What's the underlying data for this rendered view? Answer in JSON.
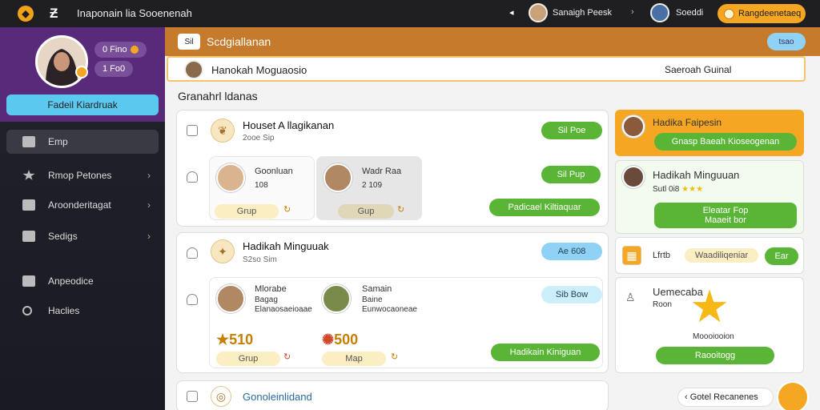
{
  "topbar": {
    "app_title": "Inaponain lia Sooenenah",
    "user1": "Sanaigh Peesk",
    "user2": "Soeddi",
    "action_button": "Rangdeenetaeq",
    "prev": "◂",
    "next": "›"
  },
  "sidebar": {
    "pill1": "0 Fino",
    "pill2": "1 Fo0",
    "profile_name": "Fadeil Kiardruak",
    "items": [
      {
        "label": "Emp",
        "active": true,
        "chevron": ""
      },
      {
        "label": "Rmop Petones",
        "active": false,
        "chevron": "›"
      },
      {
        "label": "Aroonderitagat",
        "active": false,
        "chevron": "›"
      },
      {
        "label": "Sedigs",
        "active": false,
        "chevron": "›"
      },
      {
        "label": "Anpeodice",
        "active": false,
        "chevron": ""
      },
      {
        "label": "Haclies",
        "active": false,
        "chevron": ""
      }
    ]
  },
  "header": {
    "icon_label": "Sil",
    "title": "Scdgiallanan",
    "right_button": "tsao"
  },
  "searchrow": {
    "name": "Hanokah Moguaosio",
    "value": "Saeroah Guinal"
  },
  "section_title": "Granahrl ldanas",
  "card1": {
    "title": "Houset A llagikanan",
    "sub": "2ooe Sip",
    "btn1": "Sil Poe",
    "btn2": "Sil Pup",
    "btn3": "Padicael Kiltiaquar",
    "people": [
      {
        "name": "Goonluan",
        "score": "108",
        "tag": "Grup"
      },
      {
        "name": "Wadr Raa",
        "score": "2 109",
        "tag": "Gup"
      }
    ]
  },
  "card2": {
    "title": "Hadikah Minguuak",
    "sub": "S2so Sim",
    "btn1": "Ae 608",
    "btn2": "Sib Bow",
    "btn3": "Hadikain Kiniguan",
    "people": [
      {
        "name": "Mlorabe",
        "line2": "Bagag",
        "line3": "Elanaosaeioaae",
        "points": "510",
        "tag": "Grup"
      },
      {
        "name": "Samain",
        "line2": "Baine",
        "line3": "Eunwocaoneae",
        "points": "500",
        "tag": "Map"
      }
    ]
  },
  "card3": {
    "title": "Gonoleinlidand"
  },
  "right_panel": {
    "top_name": "Hadika Faipesin",
    "top_button": "Gnasp Baeah Kioseogenan",
    "mid_name": "Hadikah Minguuan",
    "mid_sub": "Sutl 0i8",
    "mid_button_line1": "Eleatar Fop",
    "mid_button_line2": "Maaeit bor",
    "row_text": "Lfrtb",
    "row_tag": "Waadiliqeniar",
    "row_btn": "Ear",
    "bottom_name": "Uemecaba",
    "bottom_sub": "Roon",
    "bottom_caption": "Moooiooion",
    "bottom_button": "Raooitogg",
    "chip": "Gotel Recanenes"
  },
  "colors": {
    "sidebar_purple": "#5a2a7a",
    "header_orange": "#c67a2c",
    "accent_green": "#5ab536",
    "accent_blue": "#8fd2f5",
    "accent_yellow": "#f5a623"
  }
}
